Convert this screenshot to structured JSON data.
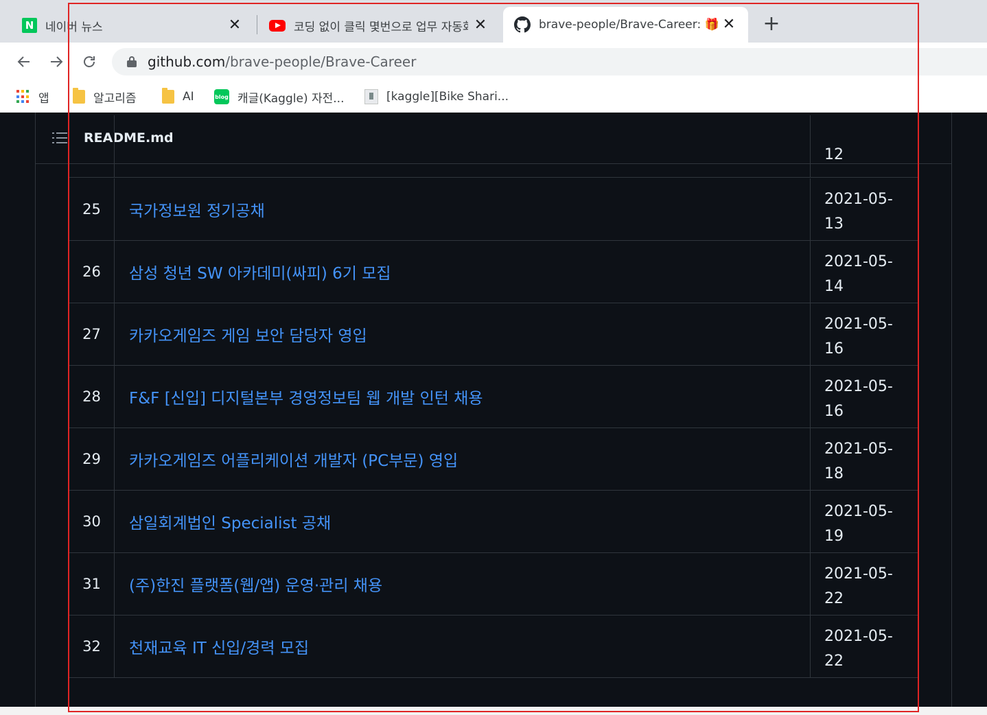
{
  "browser": {
    "tabs": [
      {
        "title": "네이버 뉴스",
        "favicon": "naver-icon"
      },
      {
        "title": "코딩 없이 클릭 몇번으로 업무 자동화",
        "favicon": "youtube-icon"
      },
      {
        "title": "brave-people/Brave-Career: 🎁",
        "favicon": "github-icon",
        "active": true
      }
    ],
    "new_tab": "+",
    "url_host": "github.com",
    "url_path": "/brave-people/Brave-Career",
    "bookmarks": [
      {
        "label": "앱",
        "icon": "apps-grid-icon"
      },
      {
        "label": "알고리즘",
        "icon": "folder-icon"
      },
      {
        "label": "AI",
        "icon": "folder-icon"
      },
      {
        "label": "캐글(Kaggle) 자전...",
        "icon": "naver-blog-icon"
      },
      {
        "label": "[kaggle][Bike Shari...",
        "icon": "page-icon"
      }
    ]
  },
  "readme": {
    "title": "README.md",
    "rows": [
      {
        "num": "",
        "title": "",
        "date_year": "",
        "date_day": "12"
      },
      {
        "num": "25",
        "title": "국가정보원 정기공채",
        "date_year": "2021-05-",
        "date_day": "13"
      },
      {
        "num": "26",
        "title": "삼성 청년 SW 아카데미(싸피) 6기 모집",
        "date_year": "2021-05-",
        "date_day": "14"
      },
      {
        "num": "27",
        "title": "카카오게임즈 게임 보안 담당자 영입",
        "date_year": "2021-05-",
        "date_day": "16"
      },
      {
        "num": "28",
        "title": "F&F [신입] 디지털본부 경영정보팀 웹 개발 인턴 채용",
        "date_year": "2021-05-",
        "date_day": "16"
      },
      {
        "num": "29",
        "title": "카카오게임즈 어플리케이션 개발자 (PC부문) 영입",
        "date_year": "2021-05-",
        "date_day": "18"
      },
      {
        "num": "30",
        "title": "삼일회계법인 Specialist 공채",
        "date_year": "2021-05-",
        "date_day": "19"
      },
      {
        "num": "31",
        "title": "(주)한진 플랫폼(웹/앱) 운영·관리 채용",
        "date_year": "2021-05-",
        "date_day": "22"
      },
      {
        "num": "32",
        "title": "천재교육 IT 신입/경력 모집",
        "date_year": "2021-05-",
        "date_day": "22"
      }
    ]
  },
  "colors": {
    "bg": "#0d1117",
    "border": "#30363d",
    "link": "#4493f8",
    "text": "#e6edf3",
    "highlight": "#e02424"
  }
}
